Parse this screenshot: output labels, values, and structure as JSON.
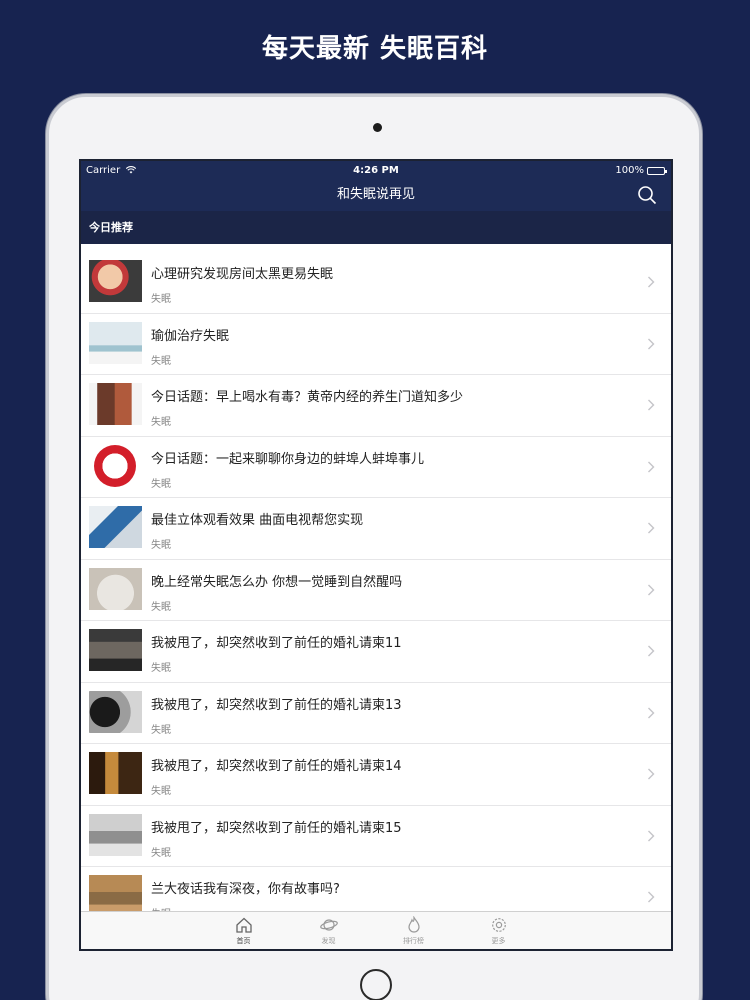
{
  "promo": {
    "title": "每天最新 失眠百科"
  },
  "status_bar": {
    "carrier": "Carrier",
    "time": "4:26 PM",
    "battery": "100%"
  },
  "nav": {
    "title": "和失眠说再见",
    "search_icon": "search-icon"
  },
  "section": {
    "title": "今日推荐"
  },
  "articles": [
    {
      "title": "心理研究发现房间太黑更易失眠",
      "category": "失眠"
    },
    {
      "title": "瑜伽治疗失眠",
      "category": "失眠"
    },
    {
      "title": "今日话题：早上喝水有毒？黄帝内经的养生门道知多少",
      "category": "失眠"
    },
    {
      "title": "今日话题：一起来聊聊你身边的蚌埠人蚌埠事儿",
      "category": "失眠"
    },
    {
      "title": "最佳立体观看效果 曲面电视帮您实现",
      "category": "失眠"
    },
    {
      "title": "晚上经常失眠怎么办 你想一觉睡到自然醒吗",
      "category": "失眠"
    },
    {
      "title": "我被甩了，却突然收到了前任的婚礼请柬11",
      "category": "失眠"
    },
    {
      "title": "我被甩了，却突然收到了前任的婚礼请柬13",
      "category": "失眠"
    },
    {
      "title": "我被甩了，却突然收到了前任的婚礼请柬14",
      "category": "失眠"
    },
    {
      "title": "我被甩了，却突然收到了前任的婚礼请柬15",
      "category": "失眠"
    },
    {
      "title": "兰大夜话我有深夜，你有故事吗?",
      "category": "失眠"
    }
  ],
  "tabs": [
    {
      "label": "首页",
      "icon": "home-icon",
      "active": true
    },
    {
      "label": "发现",
      "icon": "planet-icon",
      "active": false
    },
    {
      "label": "排行榜",
      "icon": "flame-icon",
      "active": false
    },
    {
      "label": "更多",
      "icon": "gear-icon",
      "active": false
    }
  ],
  "colors": {
    "background": "#172350",
    "navbar": "#1d2b56",
    "section": "#1b2547"
  }
}
